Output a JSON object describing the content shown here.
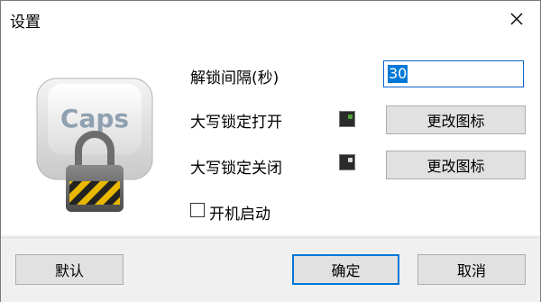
{
  "window": {
    "title": "设置",
    "close_glyph": "✕"
  },
  "icon": {
    "key_label": "Caps",
    "name": "caps-lock-padlock-icon"
  },
  "settings": {
    "unlock_interval_label": "解锁间隔(秒)",
    "unlock_interval_value": "30",
    "caps_on_label": "大写锁定打开",
    "caps_off_label": "大写锁定关闭",
    "change_icon_label_1": "更改图标",
    "change_icon_label_2": "更改图标",
    "startup_label": "开机启动",
    "startup_checked": false
  },
  "footer": {
    "default_label": "默认",
    "ok_label": "确定",
    "cancel_label": "取消"
  },
  "colors": {
    "accent": "#0078d7",
    "led_on": "#3c7a2a"
  }
}
